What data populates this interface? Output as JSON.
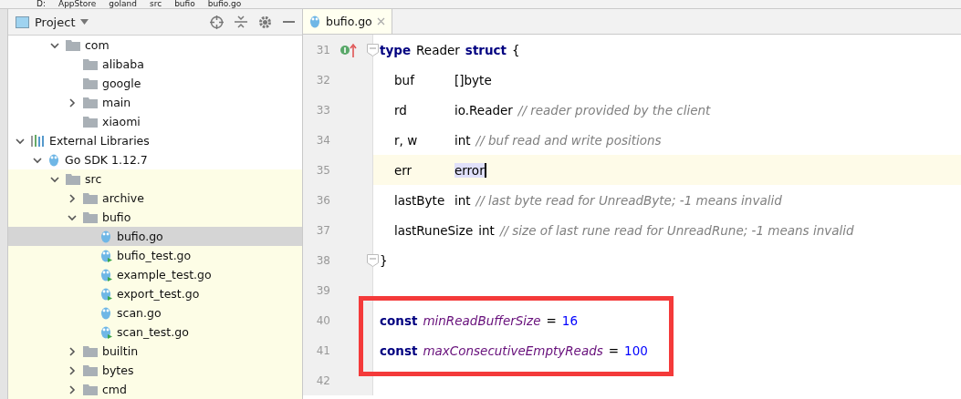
{
  "breadcrumbs": [
    "D:",
    "AppStore",
    "goland",
    "src",
    "bufio",
    "bufio.go"
  ],
  "project_panel": {
    "title": "Project",
    "scrolled_branch": [
      {
        "label": "com",
        "kind": "folder",
        "expanded": true,
        "selected": false,
        "tinted": false,
        "children": [
          {
            "label": "alibaba",
            "kind": "folder",
            "selected": false,
            "tinted": false
          },
          {
            "label": "google",
            "kind": "folder",
            "selected": false,
            "tinted": false
          },
          {
            "label": "main",
            "kind": "folder",
            "expanded": false,
            "selected": false,
            "tinted": false
          },
          {
            "label": "xiaomi",
            "kind": "folder",
            "selected": false,
            "tinted": false
          }
        ]
      }
    ],
    "tree": [
      {
        "label": "External Libraries",
        "kind": "library",
        "expanded": true,
        "selected": false,
        "tinted": false,
        "children": [
          {
            "label": "Go SDK 1.12.7",
            "kind": "sdk",
            "expanded": true,
            "selected": false,
            "tinted": false,
            "children": [
              {
                "label": "src",
                "kind": "folder",
                "expanded": true,
                "selected": false,
                "tinted": true,
                "children": [
                  {
                    "label": "archive",
                    "kind": "folder",
                    "expanded": false,
                    "selected": false,
                    "tinted": true
                  },
                  {
                    "label": "bufio",
                    "kind": "folder",
                    "expanded": true,
                    "selected": false,
                    "tinted": true,
                    "children": [
                      {
                        "label": "bufio.go",
                        "kind": "gofile",
                        "selected": true,
                        "tinted": true
                      },
                      {
                        "label": "bufio_test.go",
                        "kind": "gotest",
                        "selected": false,
                        "tinted": true
                      },
                      {
                        "label": "example_test.go",
                        "kind": "gotest",
                        "selected": false,
                        "tinted": true
                      },
                      {
                        "label": "export_test.go",
                        "kind": "gotest",
                        "selected": false,
                        "tinted": true
                      },
                      {
                        "label": "scan.go",
                        "kind": "gofile",
                        "selected": false,
                        "tinted": true
                      },
                      {
                        "label": "scan_test.go",
                        "kind": "gotest",
                        "selected": false,
                        "tinted": true
                      }
                    ]
                  },
                  {
                    "label": "builtin",
                    "kind": "folder",
                    "expanded": false,
                    "selected": false,
                    "tinted": true
                  },
                  {
                    "label": "bytes",
                    "kind": "folder",
                    "expanded": false,
                    "selected": false,
                    "tinted": true
                  },
                  {
                    "label": "cmd",
                    "kind": "folder",
                    "expanded": false,
                    "selected": false,
                    "tinted": true
                  }
                ]
              }
            ]
          }
        ]
      }
    ]
  },
  "editor": {
    "tabs": [
      {
        "label": "bufio.go",
        "selected": true
      }
    ],
    "lines": [
      {
        "number": "31",
        "current": false,
        "indented": false,
        "gutter_mark": true,
        "fold": true,
        "tokens": [
          {
            "kind": "keyword",
            "text": "type"
          },
          {
            "kind": "plain",
            "text": "Reader"
          },
          {
            "kind": "keyword",
            "text": "struct"
          },
          {
            "kind": "plain",
            "text": "{"
          }
        ]
      },
      {
        "number": "32",
        "current": false,
        "indented": true,
        "gutter_mark": false,
        "fold": false,
        "tokens": [
          {
            "kind": "field",
            "text": "buf"
          },
          {
            "kind": "plain",
            "text": "[]byte"
          }
        ]
      },
      {
        "number": "33",
        "current": false,
        "indented": true,
        "gutter_mark": false,
        "fold": false,
        "tokens": [
          {
            "kind": "field",
            "text": "rd"
          },
          {
            "kind": "plain",
            "text": "io.Reader"
          },
          {
            "kind": "comment",
            "text": "// reader provided by the client"
          }
        ]
      },
      {
        "number": "34",
        "current": false,
        "indented": true,
        "gutter_mark": false,
        "fold": false,
        "tokens": [
          {
            "kind": "field",
            "text": "r, w"
          },
          {
            "kind": "plain",
            "text": "int"
          },
          {
            "kind": "comment",
            "text": "// buf read and write positions"
          }
        ]
      },
      {
        "number": "35",
        "current": true,
        "indented": true,
        "gutter_mark": false,
        "fold": false,
        "tokens": [
          {
            "kind": "field",
            "text": "err"
          },
          {
            "kind": "selected",
            "text": "error"
          }
        ]
      },
      {
        "number": "36",
        "current": false,
        "indented": true,
        "gutter_mark": false,
        "fold": false,
        "tokens": [
          {
            "kind": "field",
            "text": "lastByte"
          },
          {
            "kind": "plain",
            "text": "int"
          },
          {
            "kind": "comment",
            "text": "// last byte read for UnreadByte; -1 means invalid"
          }
        ]
      },
      {
        "number": "37",
        "current": false,
        "indented": true,
        "gutter_mark": false,
        "fold": false,
        "tokens": [
          {
            "kind": "plain",
            "text": "lastRuneSize"
          },
          {
            "kind": "plain",
            "text": "int"
          },
          {
            "kind": "comment",
            "text": "// size of last rune read for UnreadRune; -1 means invalid"
          }
        ]
      },
      {
        "number": "38",
        "current": false,
        "indented": false,
        "gutter_mark": false,
        "fold": true,
        "tokens": [
          {
            "kind": "plain",
            "text": "}"
          }
        ]
      },
      {
        "number": "39",
        "current": false,
        "gutter_mark": false,
        "fold": false
      },
      {
        "number": "40",
        "current": false,
        "indented": false,
        "gutter_mark": false,
        "fold": false,
        "tokens": [
          {
            "kind": "keyword",
            "text": "const"
          },
          {
            "kind": "constant",
            "text": "minReadBufferSize"
          },
          {
            "kind": "plain",
            "text": "="
          },
          {
            "kind": "number",
            "text": "16"
          }
        ]
      },
      {
        "number": "41",
        "current": false,
        "indented": false,
        "gutter_mark": false,
        "fold": false,
        "tokens": [
          {
            "kind": "keyword",
            "text": "const"
          },
          {
            "kind": "constant",
            "text": "maxConsecutiveEmptyReads"
          },
          {
            "kind": "plain",
            "text": "="
          },
          {
            "kind": "number",
            "text": "100"
          }
        ]
      },
      {
        "number": "42",
        "current": false,
        "gutter_mark": false,
        "fold": false
      }
    ]
  }
}
